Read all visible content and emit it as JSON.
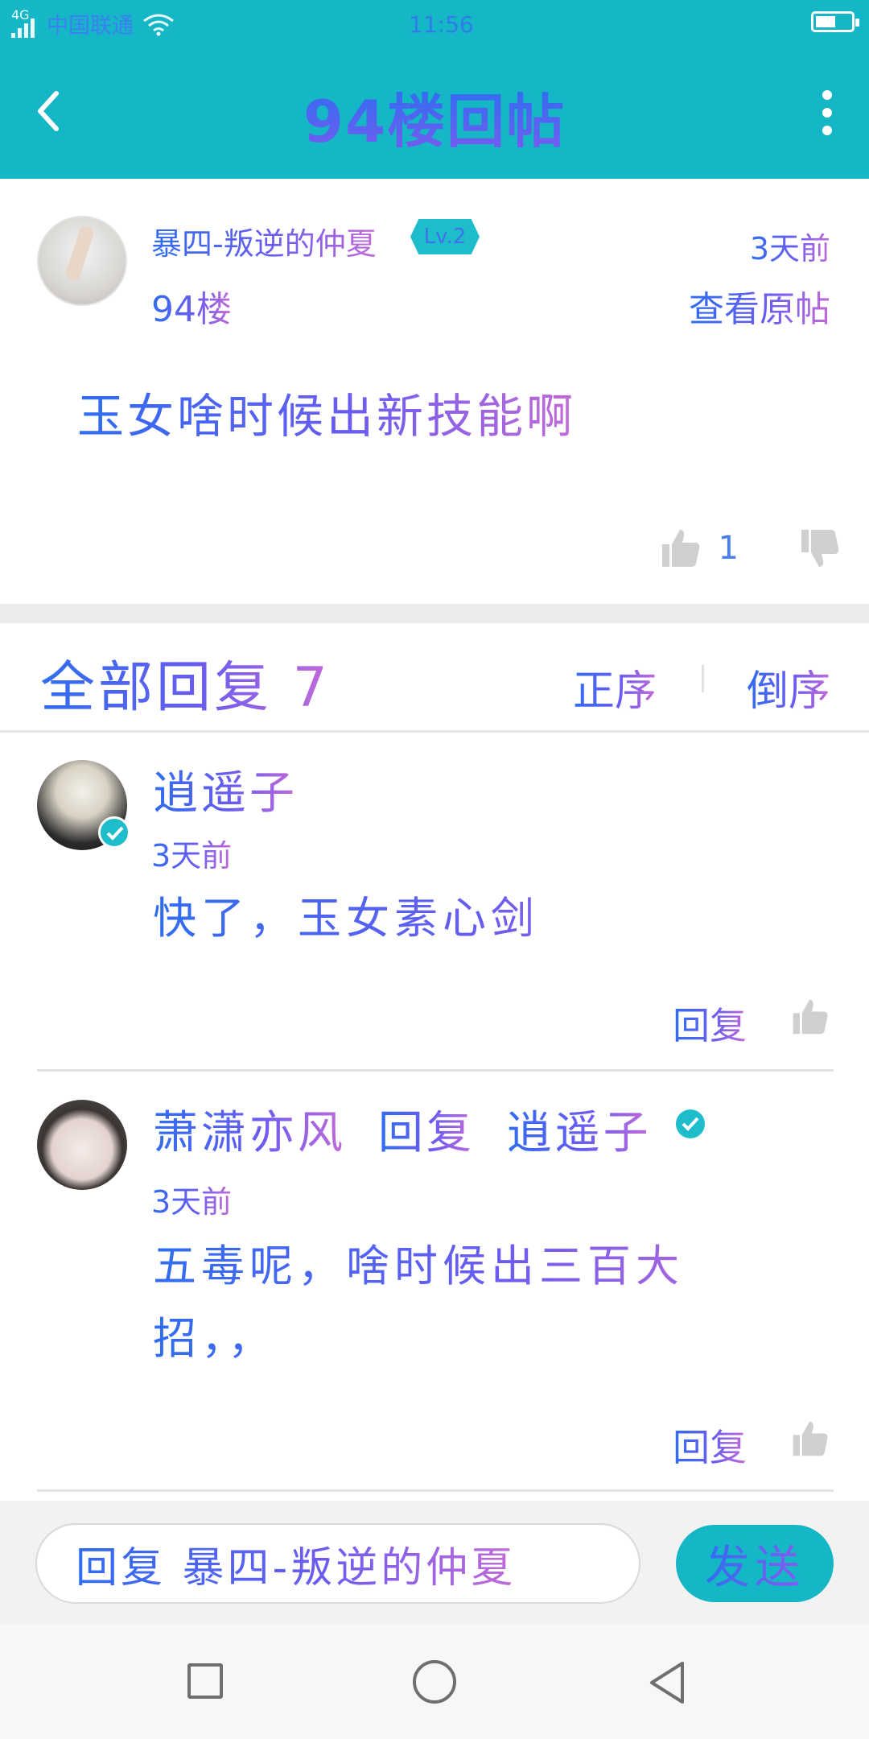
{
  "status_bar": {
    "network": "4G",
    "carrier": "中国联通",
    "time": "11:56"
  },
  "header": {
    "title": "94楼回帖",
    "back_icon": "chevron-left-icon",
    "more_icon": "more-vertical-icon"
  },
  "post": {
    "username": "暴四-叛逆的仲夏",
    "level": "Lv.2",
    "time": "3天前",
    "floor": "94楼",
    "view_original": "查看原帖",
    "content": "玉女啥时候出新技能啊",
    "like_count": "1"
  },
  "replies": {
    "title": "全部回复",
    "count": "7",
    "sort_asc": "正序",
    "sort_desc": "倒序",
    "items": [
      {
        "username": "逍遥子",
        "verified": true,
        "time": "3天前",
        "content": "快了，玉女素心剑",
        "reply_label": "回复"
      },
      {
        "username": "萧潇亦风",
        "reply_word": "回复",
        "reply_to": "逍遥子",
        "reply_to_verified": true,
        "time": "3天前",
        "content": "五毒呢，啥时候出三百大招，，",
        "reply_label": "回复"
      }
    ]
  },
  "composer": {
    "placeholder": "回复 暴四-叛逆的仲夏",
    "send_label": "发送"
  },
  "colors": {
    "accent": "#15b6c6",
    "text_blue": "#2f6df0",
    "text_purple": "#c26ad8",
    "divider": "#ececec"
  }
}
